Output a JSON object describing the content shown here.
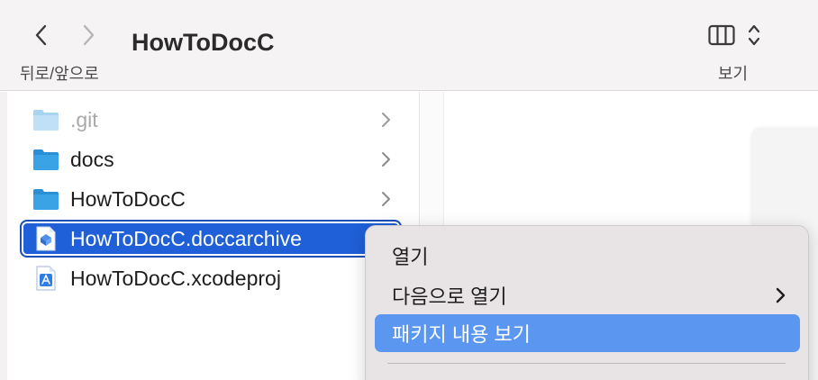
{
  "toolbar": {
    "title": "HowToDocC",
    "nav_label": "뒤로/앞으로",
    "view_label": "보기",
    "icons": {
      "back": "chevron-left-icon",
      "forward": "chevron-right-icon",
      "view": "columns-view-icon",
      "view_menu": "chevron-up-down-icon"
    }
  },
  "files": [
    {
      "name": ".git",
      "icon": "folder-icon",
      "dimmed": true,
      "has_children": true
    },
    {
      "name": "docs",
      "icon": "folder-icon",
      "dimmed": false,
      "has_children": true
    },
    {
      "name": "HowToDocC",
      "icon": "folder-icon",
      "dimmed": false,
      "has_children": true
    },
    {
      "name": "HowToDocC.doccarchive",
      "icon": "doccarchive-icon",
      "dimmed": false,
      "has_children": false,
      "selected": true
    },
    {
      "name": "HowToDocC.xcodeproj",
      "icon": "xcodeproj-icon",
      "dimmed": false,
      "has_children": false
    }
  ],
  "context_menu": {
    "items": [
      {
        "label": "열기",
        "submenu": false
      },
      {
        "label": "다음으로 열기",
        "submenu": true
      },
      {
        "label": "패키지 내용 보기",
        "submenu": false,
        "highlighted": true
      }
    ]
  },
  "colors": {
    "selection": "#1f5fd7",
    "menu_highlight": "#5b97f1",
    "folder": "#3aa3e6",
    "toolbar_bg": "#f6f3f4"
  }
}
